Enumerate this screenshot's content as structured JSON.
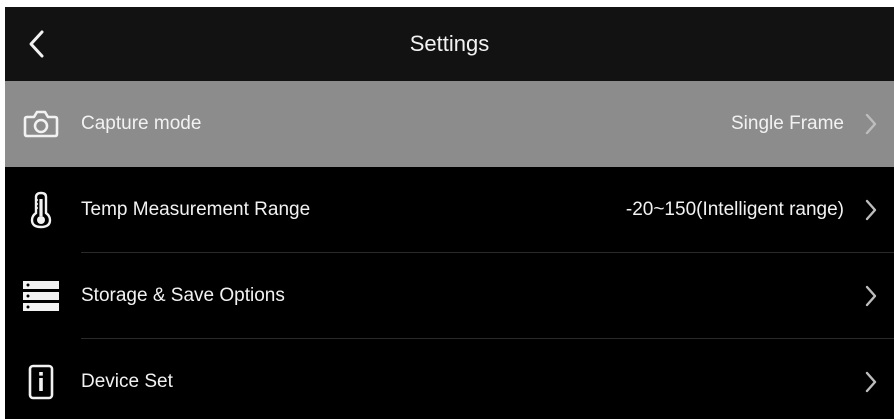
{
  "header": {
    "title": "Settings",
    "back_icon": "chevron-left-icon"
  },
  "settings": [
    {
      "label": "Capture mode",
      "value": "Single Frame",
      "icon": "camera-icon",
      "selected": true
    },
    {
      "label": "Temp Measurement Range",
      "value": "-20~150(Intelligent range)",
      "icon": "thermometer-icon",
      "selected": false
    },
    {
      "label": "Storage & Save Options",
      "value": "",
      "icon": "storage-icon",
      "selected": false
    },
    {
      "label": "Device Set",
      "value": "",
      "icon": "device-icon",
      "selected": false
    }
  ],
  "colors": {
    "background": "#000000",
    "header": "#121212",
    "selected_row": "#8c8c8c",
    "text": "#f2f2f2"
  }
}
